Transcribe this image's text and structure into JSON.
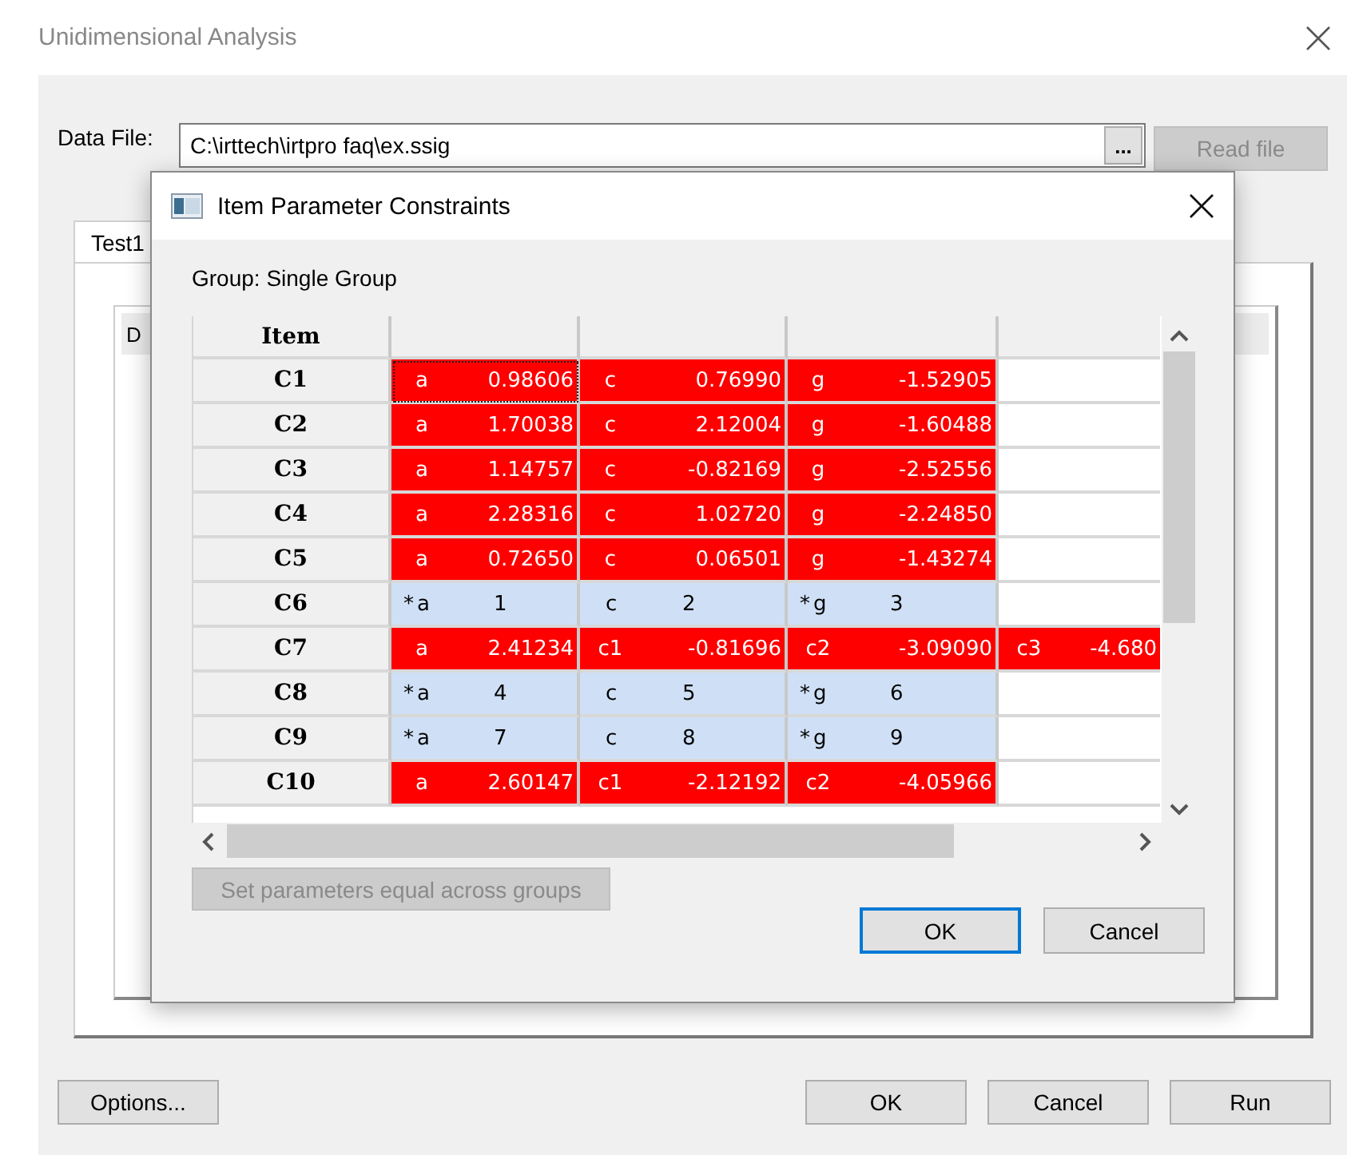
{
  "window": {
    "title": "Unidimensional Analysis"
  },
  "data_file": {
    "label": "Data File:",
    "value": "C:\\irttech\\irtpro faq\\ex.ssig",
    "browse": "...",
    "read_button": {
      "label": "Read file",
      "disabled": true
    }
  },
  "tabs": [
    {
      "label": "Test1",
      "selected": true
    }
  ],
  "inner_tab": {
    "label": "D"
  },
  "buttons": [
    {
      "label": "Options...",
      "kind": "left"
    },
    {
      "label": "OK",
      "kind": "right"
    },
    {
      "label": "Cancel",
      "kind": "right"
    },
    {
      "label": "Run",
      "kind": "right"
    }
  ],
  "dialog": {
    "title": "Item Parameter Constraints",
    "group": "Group: Single Group",
    "table": {
      "item_header": "Item",
      "rows": [
        {
          "item": "C1",
          "cells": [
            {
              "kind": "estimated",
              "param": "a",
              "value": "0.98606",
              "focused": true
            },
            {
              "kind": "estimated",
              "param": "c",
              "value": "0.76990"
            },
            {
              "kind": "estimated",
              "param": "g",
              "value": "-1.52905"
            }
          ]
        },
        {
          "item": "C2",
          "cells": [
            {
              "kind": "estimated",
              "param": "a",
              "value": "1.70038"
            },
            {
              "kind": "estimated",
              "param": "c",
              "value": "2.12004"
            },
            {
              "kind": "estimated",
              "param": "g",
              "value": "-1.60488"
            }
          ]
        },
        {
          "item": "C3",
          "cells": [
            {
              "kind": "estimated",
              "param": "a",
              "value": "1.14757"
            },
            {
              "kind": "estimated",
              "param": "c",
              "value": "-0.82169"
            },
            {
              "kind": "estimated",
              "param": "g",
              "value": "-2.52556"
            }
          ]
        },
        {
          "item": "C4",
          "cells": [
            {
              "kind": "estimated",
              "param": "a",
              "value": "2.28316"
            },
            {
              "kind": "estimated",
              "param": "c",
              "value": "1.02720"
            },
            {
              "kind": "estimated",
              "param": "g",
              "value": "-2.24850"
            }
          ]
        },
        {
          "item": "C5",
          "cells": [
            {
              "kind": "estimated",
              "param": "a",
              "value": "0.72650"
            },
            {
              "kind": "estimated",
              "param": "c",
              "value": "0.06501"
            },
            {
              "kind": "estimated",
              "param": "g",
              "value": "-1.43274"
            }
          ]
        },
        {
          "item": "C6",
          "cells": [
            {
              "kind": "constrained",
              "mark": "*",
              "param": "a",
              "value": "1"
            },
            {
              "kind": "constrained",
              "param": "c",
              "value": "2"
            },
            {
              "kind": "constrained",
              "mark": "*",
              "param": "g",
              "value": "3"
            }
          ]
        },
        {
          "item": "C7",
          "cells": [
            {
              "kind": "estimated",
              "param": "a",
              "value": "2.41234"
            },
            {
              "kind": "estimated",
              "param": "c1",
              "value": "-0.81696"
            },
            {
              "kind": "estimated",
              "param": "c2",
              "value": "-3.09090"
            },
            {
              "kind": "estimated",
              "param": "c3",
              "value": "-4.680"
            }
          ]
        },
        {
          "item": "C8",
          "cells": [
            {
              "kind": "constrained",
              "mark": "*",
              "param": "a",
              "value": "4"
            },
            {
              "kind": "constrained",
              "param": "c",
              "value": "5"
            },
            {
              "kind": "constrained",
              "mark": "*",
              "param": "g",
              "value": "6"
            }
          ]
        },
        {
          "item": "C9",
          "cells": [
            {
              "kind": "constrained",
              "mark": "*",
              "param": "a",
              "value": "7"
            },
            {
              "kind": "constrained",
              "param": "c",
              "value": "8"
            },
            {
              "kind": "constrained",
              "mark": "*",
              "param": "g",
              "value": "9"
            }
          ]
        },
        {
          "item": "C10",
          "cells": [
            {
              "kind": "estimated",
              "param": "a",
              "value": "2.60147"
            },
            {
              "kind": "estimated",
              "param": "c1",
              "value": "-2.12192"
            },
            {
              "kind": "estimated",
              "param": "c2",
              "value": "-4.05966"
            }
          ]
        }
      ]
    },
    "equal_button": {
      "label": "Set parameters equal across groups",
      "disabled": true
    },
    "buttons": [
      {
        "label": "OK",
        "default": true
      },
      {
        "label": "Cancel",
        "default": false
      }
    ]
  }
}
